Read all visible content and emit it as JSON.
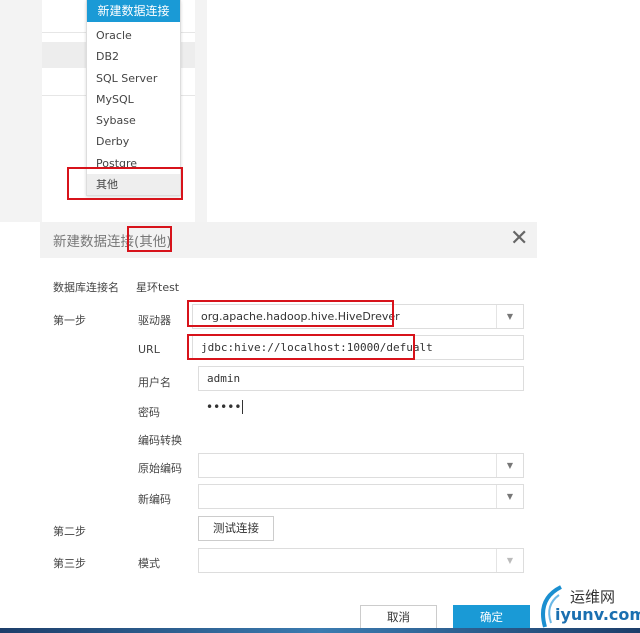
{
  "menu": {
    "header": "新建数据连接",
    "items": [
      "Oracle",
      "DB2",
      "SQL Server",
      "MySQL",
      "Sybase",
      "Derby",
      "Postgre",
      "其他"
    ],
    "selected": "其他"
  },
  "dialog": {
    "title_prefix": "新建数据连接",
    "title_suffix": "(其他)",
    "conn_name_label": "数据库连接名",
    "conn_name_value": "星环test",
    "step1": "第一步",
    "driver_label": "驱动器",
    "driver_value": "org.apache.hadoop.hive.HiveDrever",
    "url_label": "URL",
    "url_value": "jdbc:hive://localhost:10000/defualt",
    "user_label": "用户名",
    "user_value": "admin",
    "pwd_label": "密码",
    "pwd_value": "•••••",
    "encoding_label": "编码转换",
    "orig_enc_label": "原始编码",
    "orig_enc_value": "",
    "new_enc_label": "新编码",
    "new_enc_value": "",
    "step2": "第二步",
    "test_button": "测试连接",
    "step3": "第三步",
    "mode_label": "模式",
    "mode_value": "",
    "cancel": "取消",
    "confirm": "确定"
  },
  "watermark": {
    "text1": "运维网",
    "text2": "iyunv.com"
  },
  "colors": {
    "accent": "#1a9ad6",
    "highlight": "#d7131b"
  }
}
